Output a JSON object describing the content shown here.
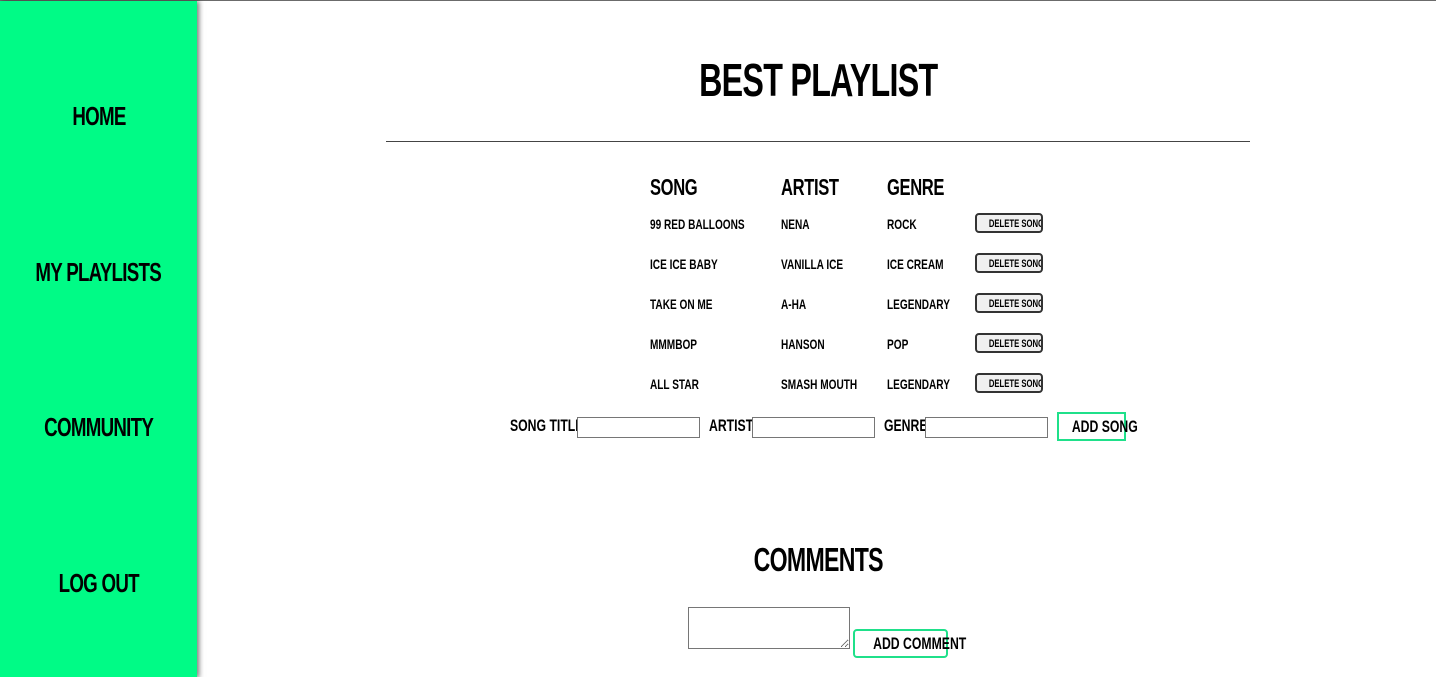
{
  "sidebar": {
    "items": [
      {
        "label": "HOME"
      },
      {
        "label": "MY PLAYLISTS"
      },
      {
        "label": "COMMUNITY"
      },
      {
        "label": "LOG OUT"
      }
    ]
  },
  "colors": {
    "sidebar_bg": "#00fb86",
    "accent_border": "#1fe08a"
  },
  "playlist": {
    "title": "BEST PLAYLIST",
    "columns": [
      "SONG",
      "ARTIST",
      "GENRE"
    ],
    "delete_label": "DELETE SONG",
    "rows": [
      {
        "song": "99 RED BALLOONS",
        "artist": "NENA",
        "genre": "ROCK"
      },
      {
        "song": "ICE ICE BABY",
        "artist": "VANILLA ICE",
        "genre": "ICE CREAM"
      },
      {
        "song": "TAKE ON ME",
        "artist": "A-HA",
        "genre": "LEGENDARY"
      },
      {
        "song": "MMMBOP",
        "artist": "HANSON",
        "genre": "POP"
      },
      {
        "song": "ALL STAR",
        "artist": "SMASH MOUTH",
        "genre": "LEGENDARY"
      }
    ]
  },
  "add_song": {
    "title_label": "SONG TITLE:",
    "artist_label": "ARTIST:",
    "genre_label": "GENRE:",
    "title_value": "",
    "artist_value": "",
    "genre_value": "",
    "button_label": "ADD SONG"
  },
  "comments": {
    "title": "COMMENTS",
    "input_value": "",
    "button_label": "ADD COMMENT"
  }
}
